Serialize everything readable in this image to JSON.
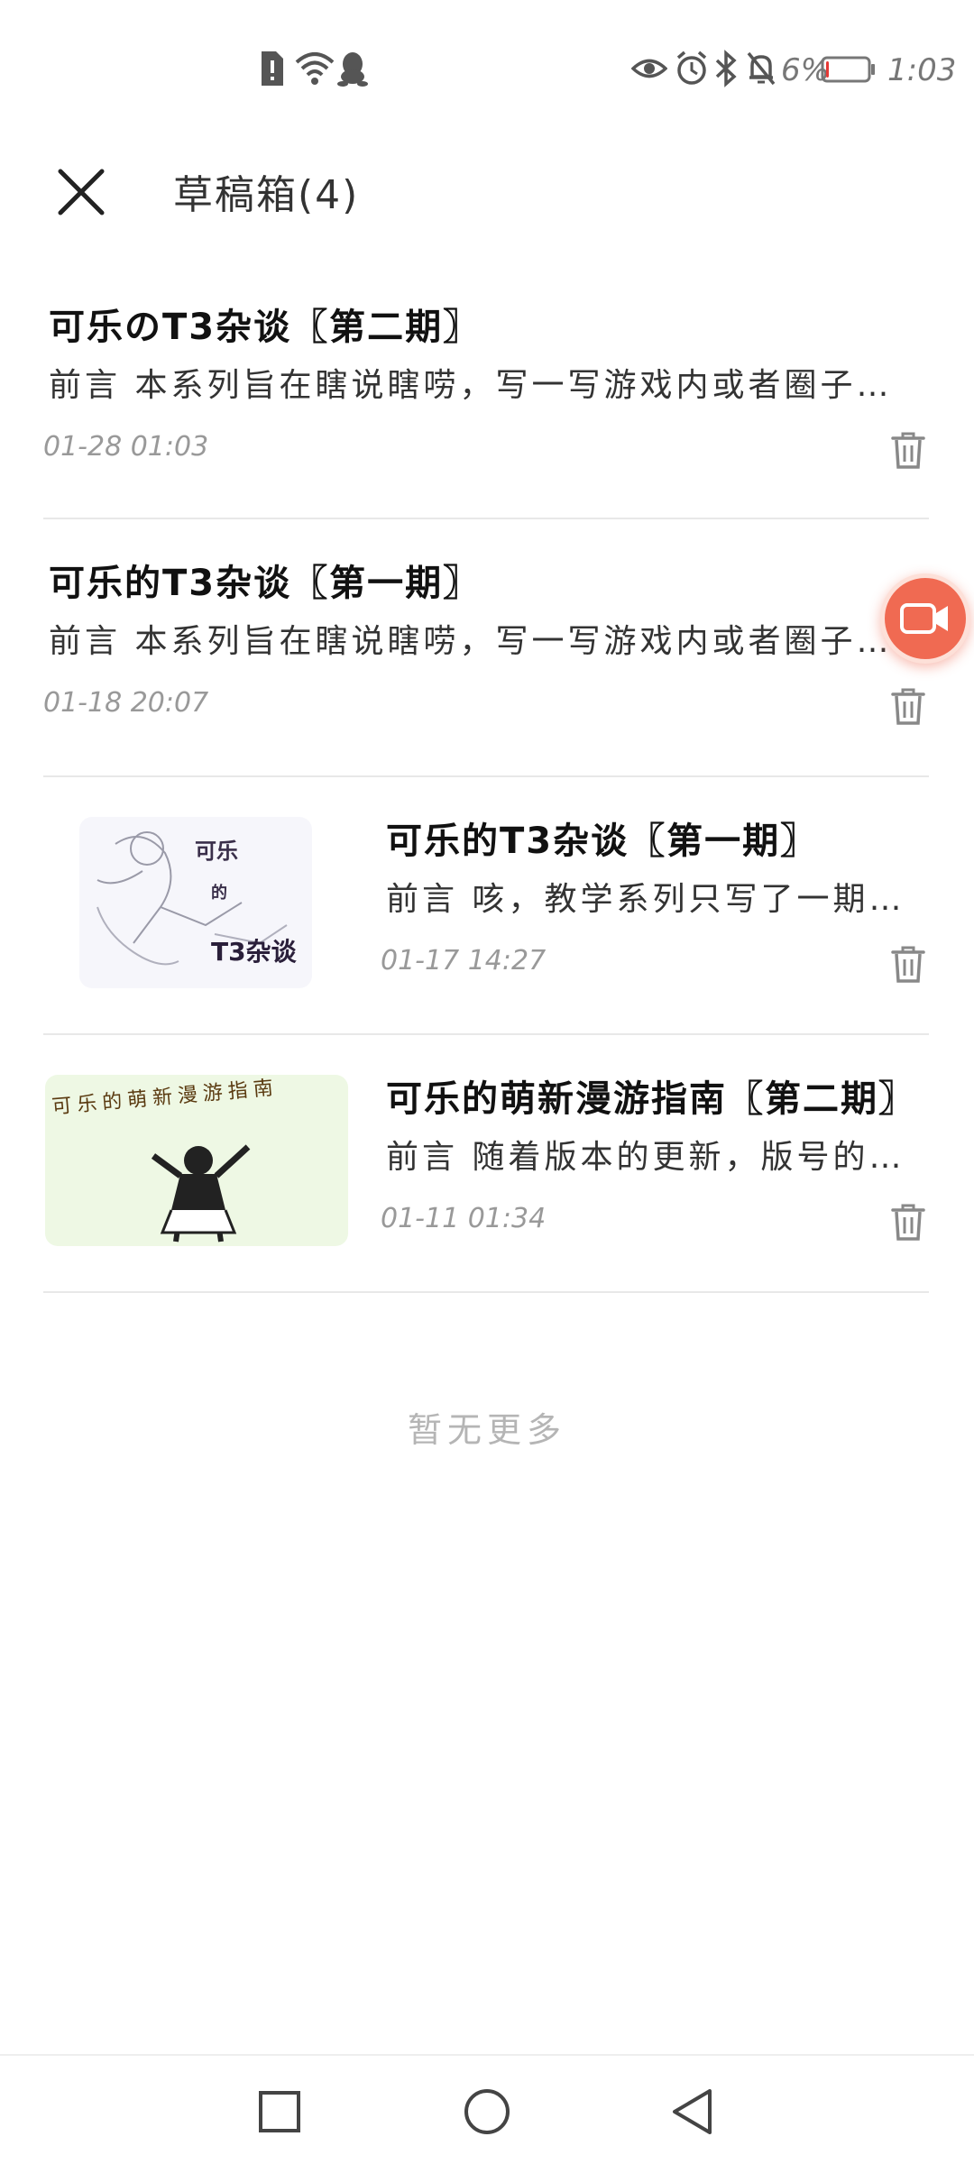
{
  "status_bar": {
    "battery_percent": "6%",
    "time": "1:03",
    "battery_level": 0.06,
    "icons": [
      "sim-alert-icon",
      "wifi-icon",
      "qq-icon",
      "eye-icon",
      "alarm-icon",
      "bluetooth-icon",
      "mute-icon",
      "battery-icon"
    ]
  },
  "header": {
    "title": "草稿箱(4)",
    "close_icon": "close-icon"
  },
  "drafts": [
    {
      "title": "可乐のT3杂谈〖第二期〗",
      "excerpt": "前言 本系列旨在瞎说瞎唠，写一写游戏内或者圈子…",
      "date": "01-28 01:03",
      "has_thumbnail": false
    },
    {
      "title": "可乐的T3杂谈〖第一期〗",
      "excerpt": "前言 本系列旨在瞎说瞎唠，写一写游戏内或者圈子…",
      "date": "01-18 20:07",
      "has_thumbnail": false
    },
    {
      "title": "可乐的T3杂谈〖第一期〗",
      "excerpt": "前言 咳，教学系列只写了一期…",
      "date": "01-17 14:27",
      "has_thumbnail": true,
      "thumbnail_text": [
        "可乐",
        "的",
        "T3杂谈"
      ]
    },
    {
      "title": "可乐的萌新漫游指南〖第二期〗",
      "excerpt": "前言 随着版本的更新，版号的…",
      "date": "01-11 01:34",
      "has_thumbnail": true,
      "thumbnail_text": [
        "可乐的萌新漫游指南"
      ]
    }
  ],
  "footer": {
    "no_more": "暂无更多"
  },
  "colors": {
    "accent": "#f06a52",
    "battery_low": "#e53935"
  }
}
